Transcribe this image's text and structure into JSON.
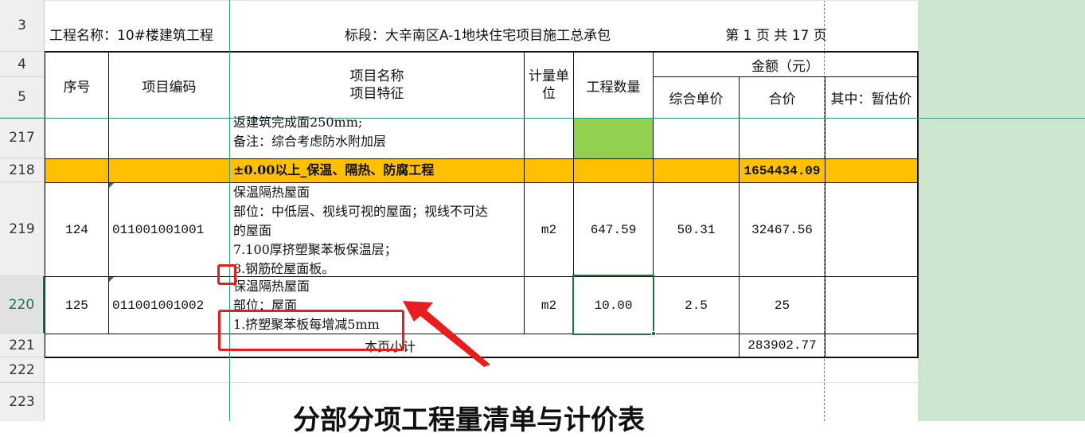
{
  "row_numbers": [
    "3",
    "4",
    "5",
    "217",
    "218",
    "219",
    "220",
    "221",
    "222",
    "223"
  ],
  "header": {
    "project_name": "工程名称：10#楼建筑工程",
    "section": "标段：大辛南区A-1地块住宅项目施工总承包",
    "page_info": "第 1 页   共 17 页"
  },
  "columns": {
    "seq": "序号",
    "code": "项目编码",
    "name_line1": "项目名称",
    "name_line2": "项目特征",
    "unit": "计量单位",
    "quantity": "工程数量",
    "amount_group": "金额（元）",
    "unit_price": "综合单价",
    "total": "合价",
    "provisional": "其中：暂估价"
  },
  "rows": {
    "r217": {
      "lines": [
        "返建筑完成面250mm;",
        "备注：综合考虑防水附加层"
      ]
    },
    "r218": {
      "title": "±0.00以上_保温、隔热、防腐工程",
      "total": "1654434.09"
    },
    "r219": {
      "seq": "124",
      "code": "011001001001",
      "lines": [
        "保温隔热屋面",
        "部位：中低层、视线可视的屋面；视线不可达",
        "的屋面",
        "7.100厚挤塑聚苯板保温层；",
        "8.钢筋砼屋面板。"
      ],
      "unit": "m2",
      "quantity": "647.59",
      "unit_price": "50.31",
      "total": "32467.56"
    },
    "r220": {
      "seq": "125",
      "code": "011001001002",
      "lines": [
        "保温隔热屋面",
        "部位：屋面",
        "1.挤塑聚苯板每增减5mm"
      ],
      "unit": "m2",
      "quantity": "10.00",
      "unit_price": "2.5",
      "total": "25"
    },
    "r221": {
      "label": "本页小计",
      "total": "283902.77"
    }
  },
  "footer_title": "分部分项工程量清单与计价表",
  "colors": {
    "highlight_row": "#ffc000",
    "green_cell": "#92d050",
    "sidebar": "#cde6d0",
    "annotation": "#e81e1e"
  }
}
